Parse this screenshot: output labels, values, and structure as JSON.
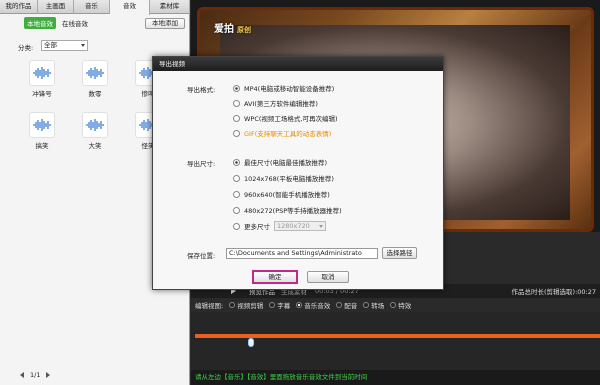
{
  "tabs": [
    "我的作品",
    "主画面",
    "音乐",
    "音效",
    "素材库"
  ],
  "active_tab": 3,
  "sub_tabs": [
    {
      "label": "本地音效",
      "active": true
    },
    {
      "label": "在线音效",
      "active": false
    }
  ],
  "local_add_button": "本地添加",
  "category": {
    "label": "分类:",
    "value": "全部"
  },
  "sounds": [
    {
      "label": "冲锋号"
    },
    {
      "label": "数零"
    },
    {
      "label": "惨叫"
    },
    {
      "label": "搞笑"
    },
    {
      "label": "大笑"
    },
    {
      "label": "怪笑"
    }
  ],
  "pager": {
    "text": "1/1"
  },
  "preview": {
    "logo": "爱拍",
    "logo_sub": "原创"
  },
  "player": {
    "preview_label": "预览作品",
    "generate_label": "生成素材",
    "time": "00:03 / 00:27",
    "total": "作品总时长(剪辑选取):00:27"
  },
  "edit_view": {
    "label": "编辑视图:",
    "options": [
      {
        "label": "视频剪辑",
        "on": false
      },
      {
        "label": "字幕",
        "on": false
      },
      {
        "label": "音乐音效",
        "on": true
      },
      {
        "label": "配音",
        "on": false
      },
      {
        "label": "转场",
        "on": false
      },
      {
        "label": "特效",
        "on": false
      }
    ]
  },
  "status_text": "请从左边【音乐】【音效】里面拖放音乐音效文件到当前时间",
  "dialog": {
    "title": "导出视频",
    "format_label": "导出格式:",
    "formats": [
      {
        "label": "MP4(电脑或移动智能设备推荐)",
        "on": true,
        "orange": false
      },
      {
        "label": "AVI(第三方软件编辑推荐)",
        "on": false,
        "orange": false
      },
      {
        "label": "WPC(视频工场格式,可再次编辑)",
        "on": false,
        "orange": false
      },
      {
        "label": "GIF(支持聊天工具的动态表情)",
        "on": false,
        "orange": true
      }
    ],
    "size_label": "导出尺寸:",
    "sizes": [
      {
        "label": "最佳尺寸(电脑最佳播放推荐)",
        "on": true
      },
      {
        "label": "1024x768(平板电脑播放推荐)",
        "on": false
      },
      {
        "label": "960x640(智能手机播放推荐)",
        "on": false
      },
      {
        "label": "480x272(PSP等手持播放器推荐)",
        "on": false
      },
      {
        "label": "更多尺寸",
        "on": false
      }
    ],
    "more_size_value": "1280x720",
    "save_label": "保存位置:",
    "save_path": "C:\\Documents and Settings\\Administrato",
    "browse_button": "选择路径",
    "ok_button": "确定",
    "cancel_button": "取消"
  }
}
